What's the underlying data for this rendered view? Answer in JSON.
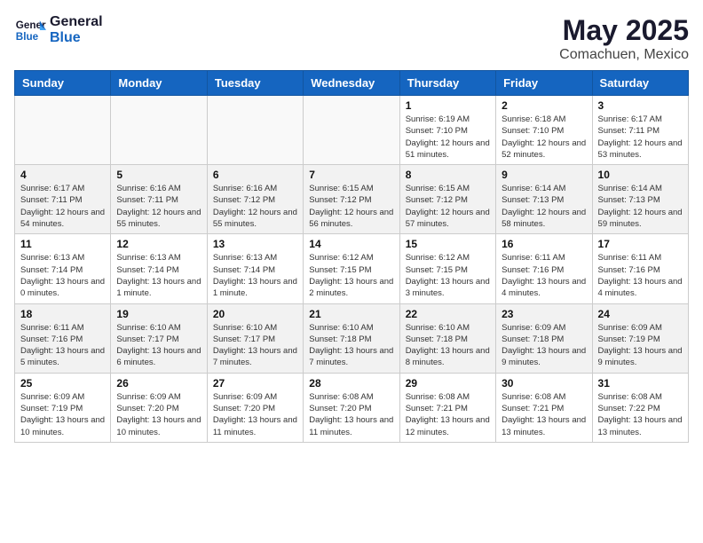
{
  "logo": {
    "line1": "General",
    "line2": "Blue"
  },
  "title": "May 2025",
  "subtitle": "Comachuen, Mexico",
  "weekdays": [
    "Sunday",
    "Monday",
    "Tuesday",
    "Wednesday",
    "Thursday",
    "Friday",
    "Saturday"
  ],
  "weeks": [
    [
      {
        "day": "",
        "info": ""
      },
      {
        "day": "",
        "info": ""
      },
      {
        "day": "",
        "info": ""
      },
      {
        "day": "",
        "info": ""
      },
      {
        "day": "1",
        "info": "Sunrise: 6:19 AM\nSunset: 7:10 PM\nDaylight: 12 hours and 51 minutes."
      },
      {
        "day": "2",
        "info": "Sunrise: 6:18 AM\nSunset: 7:10 PM\nDaylight: 12 hours and 52 minutes."
      },
      {
        "day": "3",
        "info": "Sunrise: 6:17 AM\nSunset: 7:11 PM\nDaylight: 12 hours and 53 minutes."
      }
    ],
    [
      {
        "day": "4",
        "info": "Sunrise: 6:17 AM\nSunset: 7:11 PM\nDaylight: 12 hours and 54 minutes."
      },
      {
        "day": "5",
        "info": "Sunrise: 6:16 AM\nSunset: 7:11 PM\nDaylight: 12 hours and 55 minutes."
      },
      {
        "day": "6",
        "info": "Sunrise: 6:16 AM\nSunset: 7:12 PM\nDaylight: 12 hours and 55 minutes."
      },
      {
        "day": "7",
        "info": "Sunrise: 6:15 AM\nSunset: 7:12 PM\nDaylight: 12 hours and 56 minutes."
      },
      {
        "day": "8",
        "info": "Sunrise: 6:15 AM\nSunset: 7:12 PM\nDaylight: 12 hours and 57 minutes."
      },
      {
        "day": "9",
        "info": "Sunrise: 6:14 AM\nSunset: 7:13 PM\nDaylight: 12 hours and 58 minutes."
      },
      {
        "day": "10",
        "info": "Sunrise: 6:14 AM\nSunset: 7:13 PM\nDaylight: 12 hours and 59 minutes."
      }
    ],
    [
      {
        "day": "11",
        "info": "Sunrise: 6:13 AM\nSunset: 7:14 PM\nDaylight: 13 hours and 0 minutes."
      },
      {
        "day": "12",
        "info": "Sunrise: 6:13 AM\nSunset: 7:14 PM\nDaylight: 13 hours and 1 minute."
      },
      {
        "day": "13",
        "info": "Sunrise: 6:13 AM\nSunset: 7:14 PM\nDaylight: 13 hours and 1 minute."
      },
      {
        "day": "14",
        "info": "Sunrise: 6:12 AM\nSunset: 7:15 PM\nDaylight: 13 hours and 2 minutes."
      },
      {
        "day": "15",
        "info": "Sunrise: 6:12 AM\nSunset: 7:15 PM\nDaylight: 13 hours and 3 minutes."
      },
      {
        "day": "16",
        "info": "Sunrise: 6:11 AM\nSunset: 7:16 PM\nDaylight: 13 hours and 4 minutes."
      },
      {
        "day": "17",
        "info": "Sunrise: 6:11 AM\nSunset: 7:16 PM\nDaylight: 13 hours and 4 minutes."
      }
    ],
    [
      {
        "day": "18",
        "info": "Sunrise: 6:11 AM\nSunset: 7:16 PM\nDaylight: 13 hours and 5 minutes."
      },
      {
        "day": "19",
        "info": "Sunrise: 6:10 AM\nSunset: 7:17 PM\nDaylight: 13 hours and 6 minutes."
      },
      {
        "day": "20",
        "info": "Sunrise: 6:10 AM\nSunset: 7:17 PM\nDaylight: 13 hours and 7 minutes."
      },
      {
        "day": "21",
        "info": "Sunrise: 6:10 AM\nSunset: 7:18 PM\nDaylight: 13 hours and 7 minutes."
      },
      {
        "day": "22",
        "info": "Sunrise: 6:10 AM\nSunset: 7:18 PM\nDaylight: 13 hours and 8 minutes."
      },
      {
        "day": "23",
        "info": "Sunrise: 6:09 AM\nSunset: 7:18 PM\nDaylight: 13 hours and 9 minutes."
      },
      {
        "day": "24",
        "info": "Sunrise: 6:09 AM\nSunset: 7:19 PM\nDaylight: 13 hours and 9 minutes."
      }
    ],
    [
      {
        "day": "25",
        "info": "Sunrise: 6:09 AM\nSunset: 7:19 PM\nDaylight: 13 hours and 10 minutes."
      },
      {
        "day": "26",
        "info": "Sunrise: 6:09 AM\nSunset: 7:20 PM\nDaylight: 13 hours and 10 minutes."
      },
      {
        "day": "27",
        "info": "Sunrise: 6:09 AM\nSunset: 7:20 PM\nDaylight: 13 hours and 11 minutes."
      },
      {
        "day": "28",
        "info": "Sunrise: 6:08 AM\nSunset: 7:20 PM\nDaylight: 13 hours and 11 minutes."
      },
      {
        "day": "29",
        "info": "Sunrise: 6:08 AM\nSunset: 7:21 PM\nDaylight: 13 hours and 12 minutes."
      },
      {
        "day": "30",
        "info": "Sunrise: 6:08 AM\nSunset: 7:21 PM\nDaylight: 13 hours and 13 minutes."
      },
      {
        "day": "31",
        "info": "Sunrise: 6:08 AM\nSunset: 7:22 PM\nDaylight: 13 hours and 13 minutes."
      }
    ]
  ]
}
